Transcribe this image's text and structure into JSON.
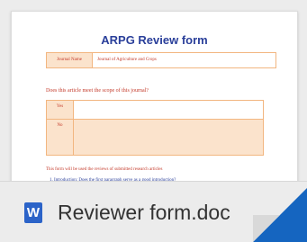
{
  "document_preview": {
    "title": "ARPG Review form",
    "journal_label": "Journal Name",
    "journal_value": "Journal of Agriculture and Crops",
    "question": "Does this article meet the scope of this journal?",
    "yes_label": "Yes",
    "no_label": "No",
    "note": "This form will be used the reviews of submitted research articles",
    "item_1": "1.   Introduction: Does the first paragraph serve as a good introduction?"
  },
  "file": {
    "icon": "word-icon",
    "icon_letter": "W",
    "name": "Reviewer form.doc"
  },
  "colors": {
    "word_blue": "#2b63c8",
    "title_blue": "#2a3f9a",
    "table_peach": "#fbe3cc",
    "corner_blue": "#1565c0"
  }
}
